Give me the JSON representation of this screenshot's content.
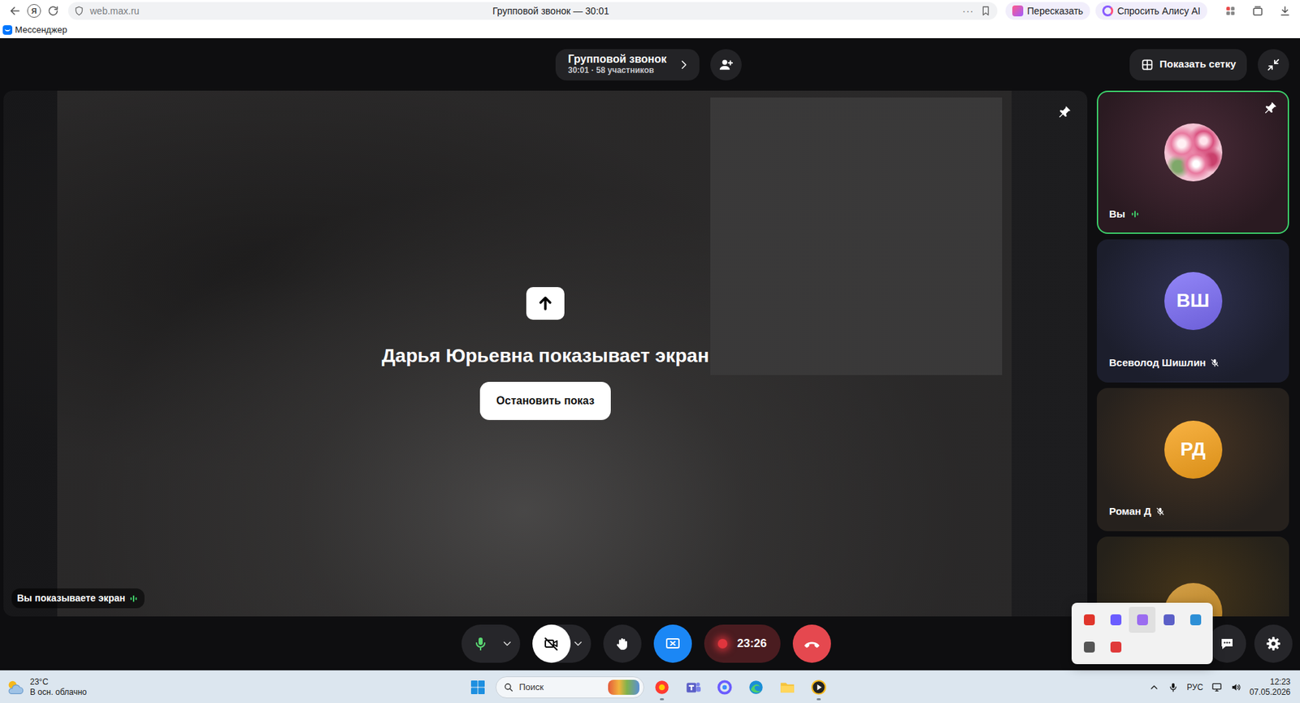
{
  "browser": {
    "logo": "Я",
    "address": "web.max.ru",
    "tab_title": "Групповой звонок — 30:01",
    "more": "···",
    "actions": [
      {
        "label": "Пересказать"
      },
      {
        "label": "Спросить Алису AI"
      }
    ],
    "bookmarks": [
      {
        "label": "Мессенджер"
      }
    ]
  },
  "call": {
    "title": "Групповой звонок",
    "subtitle": "30:01 · 58 участников",
    "grid_button": "Показать сетку"
  },
  "stage": {
    "pinned": true,
    "presenter_message": "Дарья Юрьевна показывает экран",
    "stop_button": "Остановить показ",
    "self_badge": "Вы показываете экран",
    "self_speaking": true
  },
  "participants": [
    {
      "name": "Вы",
      "kind": "photo",
      "speaking": true,
      "muted": false,
      "pinned": true,
      "selected": true,
      "color": "#e8799f"
    },
    {
      "name": "Всеволод Шишлин",
      "initials": "ВШ",
      "kind": "initials",
      "speaking": false,
      "muted": true,
      "pinned": false,
      "selected": false,
      "color": "#7b6cf6"
    },
    {
      "name": "Роман Д",
      "initials": "РД",
      "kind": "initials",
      "speaking": false,
      "muted": true,
      "pinned": false,
      "selected": false,
      "color": "#f7a21b"
    },
    {
      "kind": "cut",
      "speaking": false,
      "muted": false,
      "pinned": false,
      "selected": false,
      "color": "#c98a1f"
    }
  ],
  "controls": [
    {
      "kind": "mic",
      "on": true,
      "menu": true
    },
    {
      "kind": "camera",
      "on": false,
      "menu": true
    },
    {
      "kind": "hand",
      "on": false
    },
    {
      "kind": "share",
      "on": true
    },
    {
      "kind": "record",
      "on": true,
      "time": "23:26"
    },
    {
      "kind": "hangup",
      "on": false
    }
  ],
  "side_controls": [
    {
      "kind": "chat"
    },
    {
      "kind": "settings"
    }
  ],
  "tray_popup": {
    "open": true,
    "items": [
      {
        "color": "#e0352b",
        "selected": false
      },
      {
        "color": "#6b5cff",
        "selected": false
      },
      {
        "color": "#9b6cf0",
        "selected": true
      },
      {
        "color": "#5b5fc7",
        "selected": false
      },
      {
        "color": "#2d8fd6",
        "selected": false
      },
      {
        "color": "#555555",
        "selected": false
      },
      {
        "color": "#e03a3a",
        "selected": false
      }
    ]
  },
  "taskbar": {
    "weather": {
      "temp": "23°C",
      "condition": "В осн. облачно"
    },
    "search": {
      "placeholder": "Поиск"
    },
    "apps": [
      {
        "kind": "yandex",
        "running": true
      },
      {
        "kind": "teams",
        "running": false
      },
      {
        "kind": "messenger",
        "running": false
      },
      {
        "kind": "edge",
        "running": false
      },
      {
        "kind": "folder",
        "running": false
      },
      {
        "kind": "player",
        "running": true
      }
    ],
    "language": "РУС",
    "time": "12:23",
    "date": "07.05.2026"
  }
}
